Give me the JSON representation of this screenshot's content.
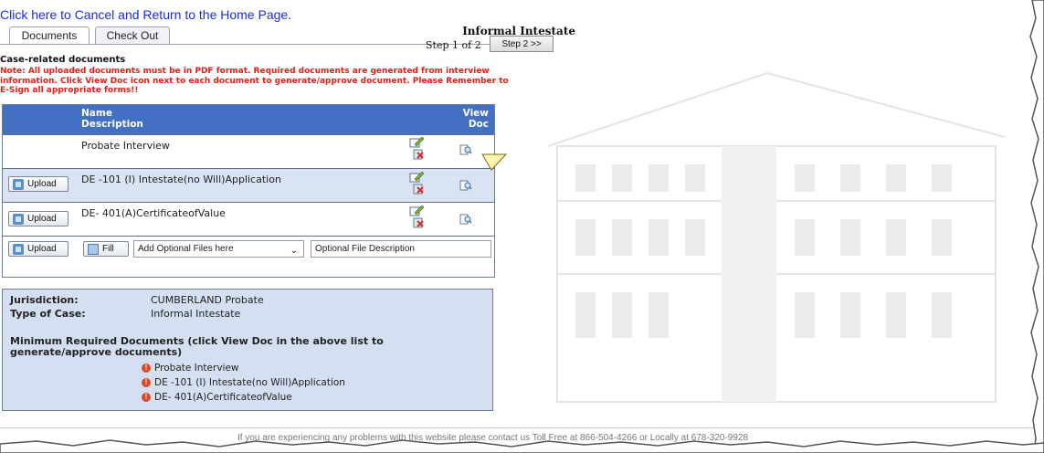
{
  "header": {
    "cancel_link": "Click here to Cancel and Return to the Home Page.",
    "title": "Informal Intestate",
    "step_text": "Step 1 of 2",
    "next_step_button": "Step 2 >>"
  },
  "tabs": [
    {
      "label": "Documents",
      "active": true
    },
    {
      "label": "Check Out",
      "active": false
    }
  ],
  "section": {
    "heading": "Case-related documents",
    "note": "Note: All uploaded documents must be in PDF format. Required documents are generated from interview information. Click View Doc icon next to each document to generate/approve document. Please Remember to E-Sign all appropriate forms!!"
  },
  "table": {
    "header_name": "Name",
    "header_description": "Description",
    "header_view": "View",
    "header_doc": "Doc",
    "rows": [
      {
        "name": "Probate Interview",
        "has_upload": false
      },
      {
        "name": "DE -101 (I) Intestate(no Will)Application",
        "has_upload": true
      },
      {
        "name": "DE- 401(A)CertificateofValue",
        "has_upload": true
      }
    ],
    "upload_label": "Upload",
    "fill_label": "Fill",
    "optional_select": "Add Optional Files here",
    "optional_description_placeholder": "Optional File Description"
  },
  "info": {
    "jurisdiction_label": "Jurisdiction:",
    "jurisdiction_value": "CUMBERLAND Probate",
    "case_type_label": "Type of Case:",
    "case_type_value": "Informal Intestate",
    "min_docs_title": "Minimum Required Documents (click View Doc in the above list to generate/approve documents)",
    "min_docs": [
      "Probate Interview",
      "DE -101 (I) Intestate(no Will)Application",
      "DE- 401(A)CertificateofValue"
    ]
  },
  "footer": {
    "text": "If you are experiencing any problems with this website please contact us Toll Free at 866-504-4266 or Locally at 678-320-9928"
  },
  "colors": {
    "table_header": "#4470c4",
    "alt_row": "#cddaf0",
    "note_red": "#e0201c",
    "link_blue": "#1a2fd6"
  }
}
